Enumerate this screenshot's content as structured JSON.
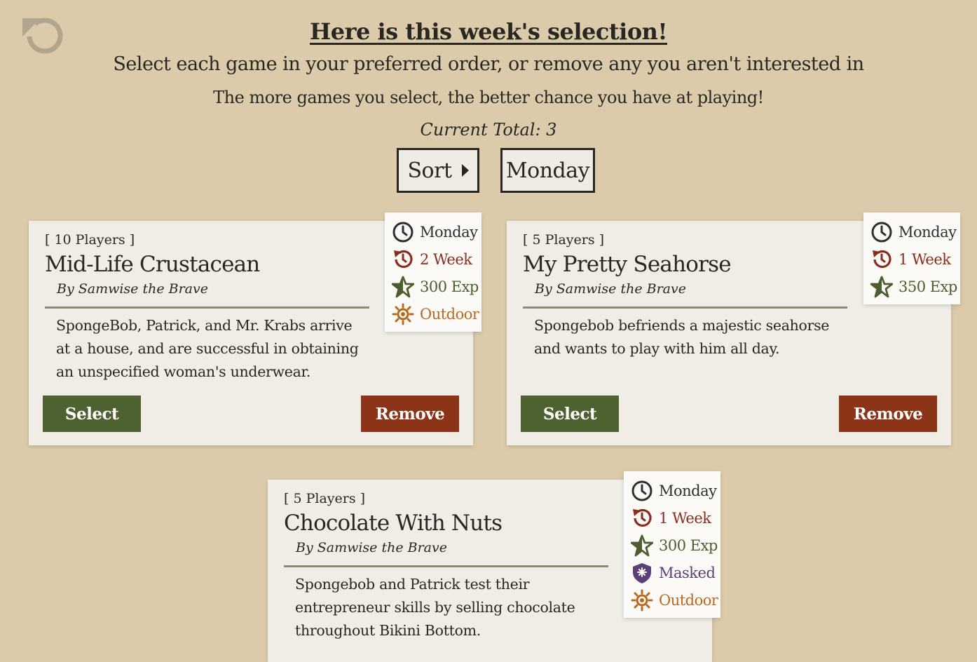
{
  "header": {
    "title": "Here is this week's selection!",
    "subtitle": "Select each game in your preferred order, or remove any you aren't interested in",
    "note": "The more games you select, the better chance you have at playing!",
    "current_total": "Current Total: 3"
  },
  "controls": {
    "sort_label": "Sort",
    "day_label": "Monday"
  },
  "icons": {
    "undo": "undo-icon",
    "day": "clock-icon",
    "week": "history-icon",
    "exp": "star-icon",
    "outdoor": "sun-icon",
    "masked": "mask-badge-icon"
  },
  "colors": {
    "background": "#dccbab",
    "select": "#4e6130",
    "remove": "#8c3418",
    "week": "#8a2d1c",
    "exp": "#4c5e2f",
    "outdoor": "#b96a22",
    "masked": "#5b3f78"
  },
  "games": [
    {
      "players": "[ 10 Players ]",
      "name": "Mid-Life Crustacean",
      "author": "By Samwise the Brave",
      "description": "SpongeBob, Patrick, and Mr. Krabs arrive at a house, and are successful in obtaining an unspecified woman's underwear.",
      "select_label": "Select",
      "remove_label": "Remove",
      "tags": {
        "day": "Monday",
        "week": "2 Week",
        "exp": "300 Exp",
        "outdoor": "Outdoor"
      }
    },
    {
      "players": "[ 5 Players ]",
      "name": "My Pretty Seahorse",
      "author": "By Samwise the Brave",
      "description": "Spongebob befriends a majestic seahorse and wants to play with him all day.",
      "select_label": "Select",
      "remove_label": "Remove",
      "tags": {
        "day": "Monday",
        "week": "1 Week",
        "exp": "350 Exp"
      }
    },
    {
      "players": "[ 5 Players ]",
      "name": "Chocolate With Nuts",
      "author": "By Samwise the Brave",
      "description": "Spongebob and Patrick test their entrepreneur skills by selling chocolate throughout Bikini Bottom.",
      "tags": {
        "day": "Monday",
        "week": "1 Week",
        "exp": "300 Exp",
        "masked": "Masked",
        "outdoor": "Outdoor"
      }
    }
  ]
}
